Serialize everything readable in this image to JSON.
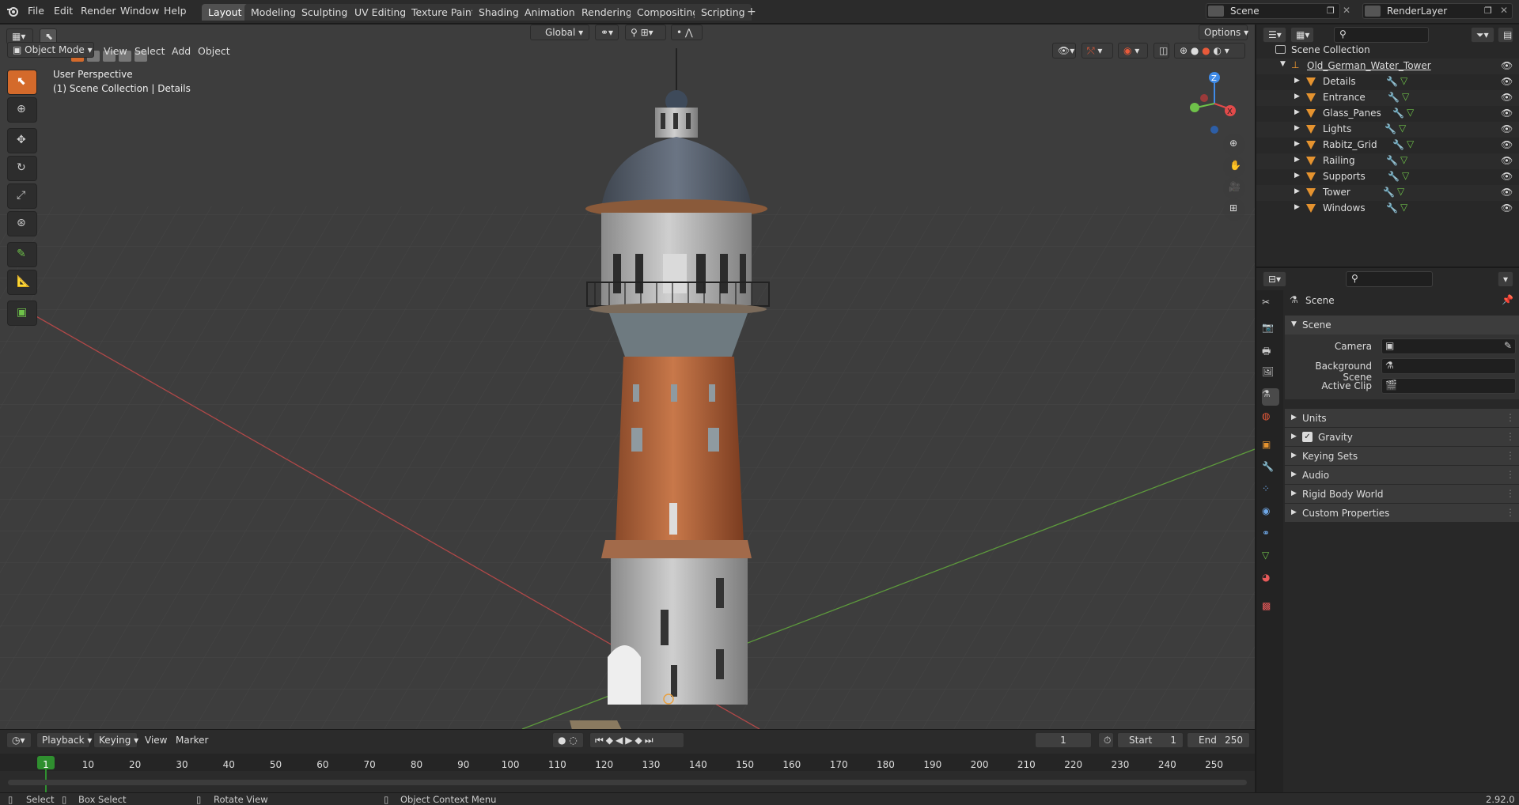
{
  "menus": [
    "File",
    "Edit",
    "Render",
    "Window",
    "Help"
  ],
  "workspaces": [
    "Layout",
    "Modeling",
    "Sculpting",
    "UV Editing",
    "Texture Paint",
    "Shading",
    "Animation",
    "Rendering",
    "Compositing",
    "Scripting"
  ],
  "active_workspace": "Layout",
  "scene_name": "Scene",
  "render_layer": "RenderLayer",
  "viewport": {
    "mode": "Object Mode",
    "menus": [
      "View",
      "Select",
      "Add",
      "Object"
    ],
    "transform_orientation": "Global",
    "options_label": "Options",
    "perspective_label": "User Perspective",
    "collection_label": "(1) Scene Collection | Details",
    "gizmo": {
      "x": "X",
      "y": "Y",
      "z": "Z"
    }
  },
  "outliner": {
    "root": "Scene Collection",
    "collection": "Old_German_Water_Tower",
    "objects": [
      "Details",
      "Entrance",
      "Glass_Panes",
      "Lights",
      "Rabitz_Grid",
      "Railing",
      "Supports",
      "Tower",
      "Windows"
    ]
  },
  "properties": {
    "context_title": "Scene",
    "panel_scene": "Scene",
    "fields": {
      "camera": "Camera",
      "background_scene": "Background Scene",
      "active_clip": "Active Clip"
    },
    "panels": [
      "Units",
      "Gravity",
      "Keying Sets",
      "Audio",
      "Rigid Body World",
      "Custom Properties"
    ],
    "gravity_checked": true
  },
  "timeline": {
    "menus": [
      "Playback",
      "Keying",
      "View",
      "Marker"
    ],
    "current_frame": "1",
    "start_label": "Start",
    "start": "1",
    "end_label": "End",
    "end": "250",
    "ruler": [
      "1",
      "10",
      "20",
      "30",
      "40",
      "50",
      "60",
      "70",
      "80",
      "90",
      "100",
      "110",
      "120",
      "130",
      "140",
      "150",
      "160",
      "170",
      "180",
      "190",
      "200",
      "210",
      "220",
      "230",
      "240",
      "250"
    ]
  },
  "status": {
    "select": "Select",
    "box_select": "Box Select",
    "rotate_view": "Rotate View",
    "context_menu": "Object Context Menu",
    "version": "2.92.0"
  },
  "colors": {
    "accent": "#d46a2b",
    "object_icon": "#e5932f",
    "axis_x": "#e24a4a",
    "axis_y": "#6fc24a",
    "axis_z": "#3f8be8",
    "frame_marker": "#2f8f2f"
  }
}
